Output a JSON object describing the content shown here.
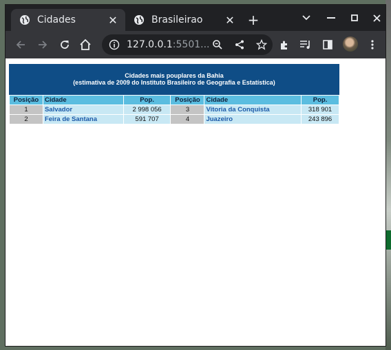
{
  "browser": {
    "tabs": [
      {
        "label": "Cidades",
        "active": true
      },
      {
        "label": "Brasileirao",
        "active": false
      }
    ],
    "new_tab_label": "+",
    "address": {
      "host": "127.0.0.1",
      "rest": ":5501..."
    }
  },
  "page": {
    "table_title": "Cidades mais pouplares da Bahia",
    "table_subtitle": "(estimativa de 2009 do Instituto Brasileiro de Geografia e Estatística)",
    "headers": [
      "Posição",
      "Cidade",
      "Pop.",
      "Posição",
      "Cidade",
      "Pop."
    ],
    "rows": [
      [
        {
          "pos": "1",
          "city": "Salvador",
          "pop": "2 998 056"
        },
        {
          "pos": "3",
          "city": "Vitoria da Conquista",
          "pop": "318 901"
        }
      ],
      [
        {
          "pos": "2",
          "city": "Feira de Santana",
          "pop": "591 707"
        },
        {
          "pos": "4",
          "city": "Juazeiro",
          "pop": "243 896"
        }
      ]
    ]
  }
}
